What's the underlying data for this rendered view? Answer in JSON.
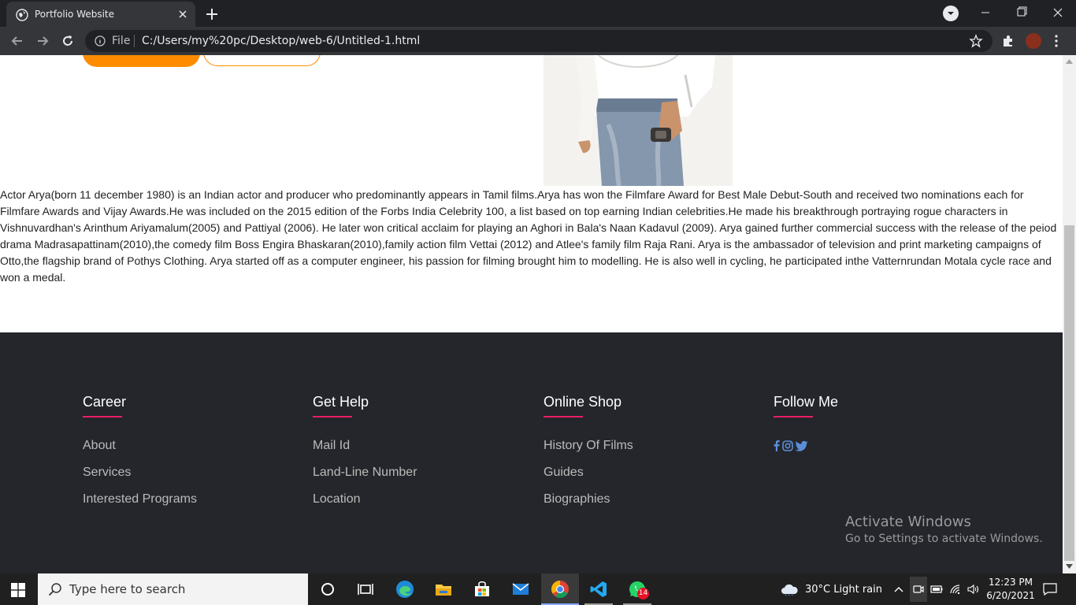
{
  "browser": {
    "tab": {
      "title": "Portfolio Website"
    },
    "omnibox": {
      "scheme": "File",
      "url": "C:/Users/my%20pc/Desktop/web-6/Untitled-1.html"
    }
  },
  "page": {
    "bio": "Actor Arya(born 11 december 1980) is an Indian actor and producer who predominantly appears in Tamil films.Arya has won the Filmfare Award for Best Male Debut-South and received two nominations each for Filmfare Awards and Vijay Awards.He was included on the 2015 edition of the Forbs India Celebrity 100, a list based on top earning Indian celebrities.He made his breakthrough portraying rogue characters in Vishnuvardhan's Arinthum Ariyamalum(2005) and Pattiyal (2006). He later won critical acclaim for playing an Aghori in Bala's Naan Kadavul (2009). Arya gained further commercial success with the release of the peiod drama Madrasapattinam(2010),the comedy film Boss Engira Bhaskaran(2010),family action film Vettai (2012) and Atlee's family film Raja Rani. Arya is the ambassador of television and print marketing campaigns of Otto,the flagship brand of Pothys Clothing. Arya started off as a computer engineer, his passion for filming brought him to modelling. He is also well in cycling, he participated inthe Vatternrundan Motala cycle race and won a medal.",
    "footer": {
      "columns": [
        {
          "title": "Career",
          "links": [
            "About",
            "Services",
            "Interested Programs"
          ]
        },
        {
          "title": "Get Help",
          "links": [
            "Mail Id",
            "Land-Line Number",
            "Location"
          ]
        },
        {
          "title": "Online Shop",
          "links": [
            "History Of Films",
            "Guides",
            "Biographies"
          ]
        },
        {
          "title": "Follow Me",
          "social": [
            "facebook-icon",
            "instagram-icon",
            "twitter-icon"
          ]
        }
      ]
    },
    "watermark": {
      "line1": "Activate Windows",
      "line2": "Go to Settings to activate Windows."
    }
  },
  "taskbar": {
    "search_placeholder": "Type here to search",
    "apps": [
      "cortana-icon",
      "task-view-icon",
      "edge-icon",
      "file-explorer-icon",
      "store-icon",
      "mail-icon",
      "chrome-icon",
      "vscode-icon",
      "whatsapp-icon"
    ],
    "whatsapp_badge": "14",
    "weather": "30°C  Light rain",
    "time": "12:23 PM",
    "date": "6/20/2021"
  },
  "colors": {
    "accent_orange": "#ff8c00",
    "footer_bg": "#24262b",
    "footer_underline": "#e91e63",
    "social_icons": "#5b8ed8"
  }
}
